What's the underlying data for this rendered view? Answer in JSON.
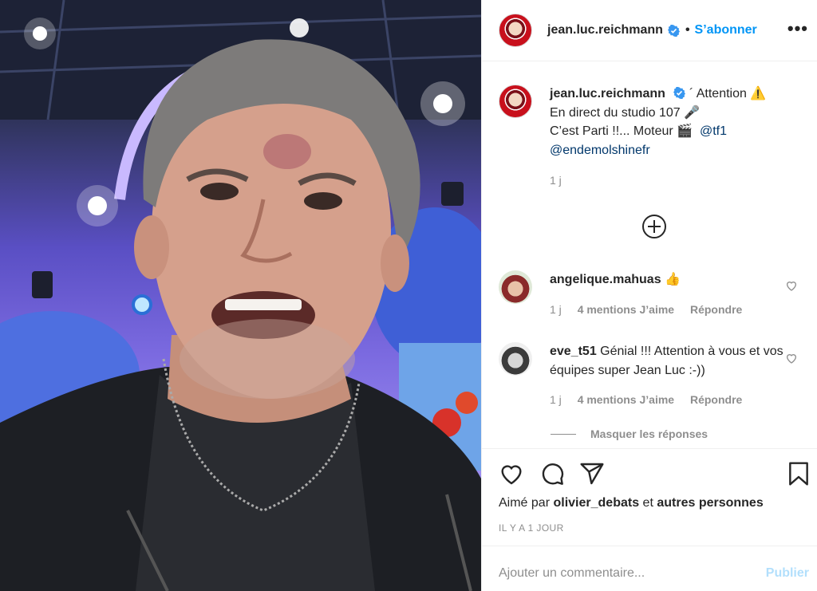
{
  "post": {
    "author": "jean.luc.reichmann",
    "follow_label": "S’abonner",
    "more_label": "•••"
  },
  "caption": {
    "author": "jean.luc.reichmann",
    "line1": "´ Attention ⚠️",
    "line2": "En direct du studio 107 🎤",
    "line3": "C’est Parti !!... Moteur 🎬",
    "mention1": "@tf1",
    "mention2": "@endemolshinefr",
    "time": "1 j"
  },
  "comments": [
    {
      "author": "angelique.mahuas",
      "text": "👍",
      "time": "1 j",
      "likes": "4 mentions J’aime",
      "reply": "Répondre"
    },
    {
      "author": "eve_t51",
      "text": "Génial !!! Attention à vous et vos équipes super Jean Luc :-))",
      "time": "1 j",
      "likes": "4 mentions J’aime",
      "reply": "Répondre"
    }
  ],
  "hide_replies_label": "Masquer les réponses",
  "likes": {
    "prefix": "Aimé par",
    "user": "olivier_debats",
    "middle": "et",
    "others": "autres personnes"
  },
  "time_ago": "IL Y A 1 JOUR",
  "add_comment": {
    "placeholder": "Ajouter un commentaire...",
    "publish_label": "Publier"
  },
  "colors": {
    "accent": "#0095f6",
    "verified": "#3897f0",
    "publish_disabled": "#b2dffc"
  }
}
